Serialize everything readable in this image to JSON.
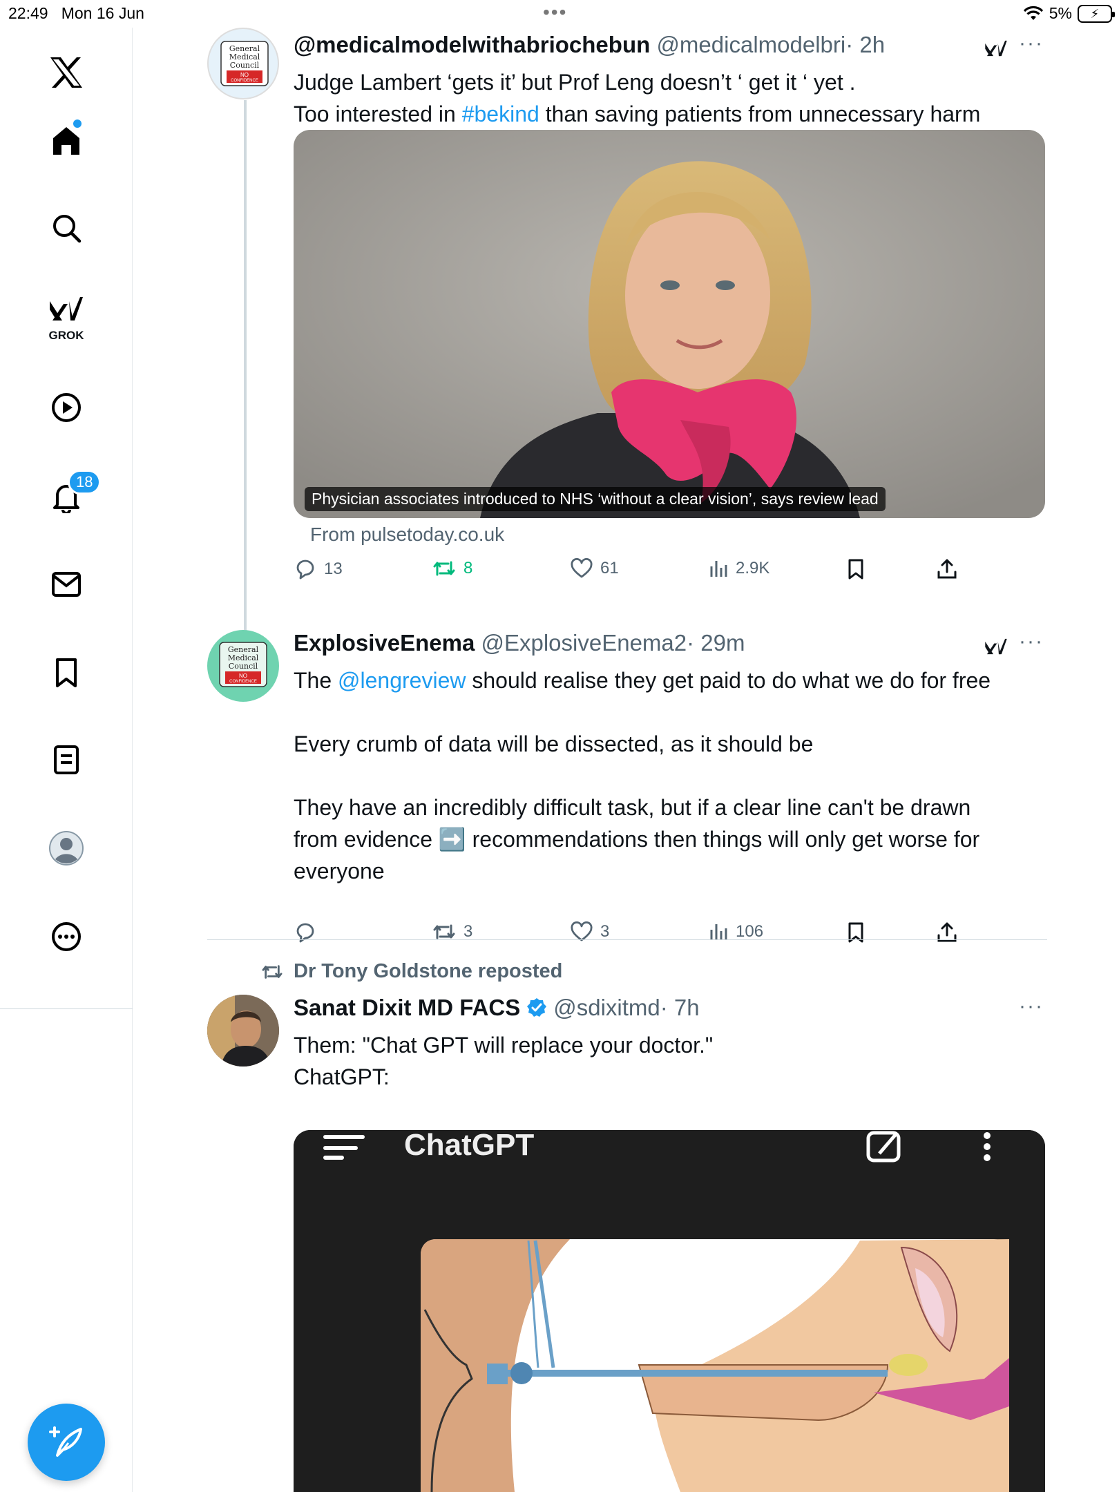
{
  "status_bar": {
    "time": "22:49",
    "date": "Mon 16 Jun",
    "battery": "5%"
  },
  "sidebar": {
    "grok_label": "GROK",
    "notifications_badge": "18"
  },
  "posts": [
    {
      "display_name": "@medicalmodelwithabriochebun",
      "handle": "@medicalmodelbri",
      "time": "· 2h",
      "text_line1": "Judge Lambert ‘gets it’ but Prof Leng doesn’t ‘ get it ‘ yet .",
      "text_line2_pre": "Too interested in ",
      "text_line2_link": "#bekind",
      "text_line2_post": " than saving patients from unnecessary harm",
      "avatar_text": [
        "General",
        "Medical",
        "Council",
        "NO",
        "CONFIDENCE"
      ],
      "card_caption": "Physician associates introduced to NHS ‘without a clear vision’, says review lead",
      "card_source": "From pulsetoday.co.uk",
      "replies": "13",
      "reposts": "8",
      "likes": "61",
      "views": "2.9K"
    },
    {
      "display_name": "ExplosiveEnema",
      "handle": "@ExplosiveEnema2",
      "time": "· 29m",
      "p1_pre": "The ",
      "p1_link": "@lengreview",
      "p1_post": " should realise they get paid to do what we do for free",
      "p2": "Every crumb of data will be dissected, as it should be",
      "p3_l1": "They have an incredibly difficult task, but if a clear line can't be drawn",
      "p3_l2_pre": "from evidence ",
      "p3_l2_emoji": "➡️",
      "p3_l2_post": " recommendations then things will only get worse for",
      "p3_l3": "everyone",
      "avatar_text": [
        "General",
        "Medical",
        "Council",
        "NO",
        "CONFIDENCE"
      ],
      "replies": "",
      "reposts": "3",
      "likes": "3",
      "views": "106"
    },
    {
      "reposted_by": "Dr Tony Goldstone reposted",
      "display_name": "Sanat Dixit MD FACS",
      "handle": "@sdixitmd",
      "time": "· 7h",
      "text_line1": "Them: \"Chat GPT will replace your doctor.\"",
      "text_line2": "ChatGPT:",
      "media_title": "ChatGPT"
    }
  ],
  "colors": {
    "accent": "#1d9bf0",
    "text": "#0f1419",
    "secondary": "#536471",
    "repost_green": "#00ba7c",
    "scarf": "#e6356f"
  }
}
